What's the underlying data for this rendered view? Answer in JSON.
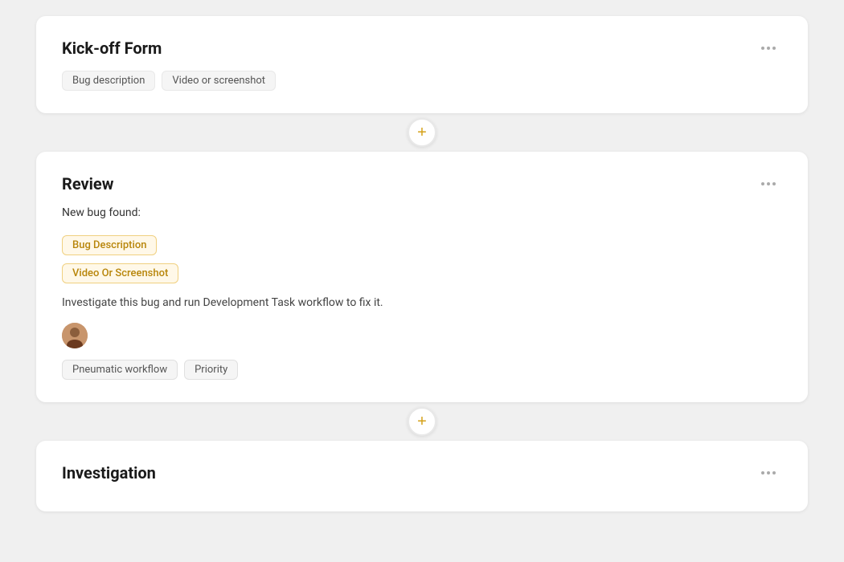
{
  "cards": [
    {
      "id": "kickoff",
      "title": "Kick-off Form",
      "tags": [
        "Bug description",
        "Video or screenshot"
      ],
      "dots_label": "options"
    },
    {
      "id": "review",
      "title": "Review",
      "new_bug_label": "New bug found:",
      "highlight_tags": [
        "Bug Description",
        "Video Or Screenshot"
      ],
      "investigate_text": "Investigate this bug and run Development Task workflow to fix it.",
      "workflow_tags": [
        "Pneumatic workflow",
        "Priority"
      ],
      "dots_label": "options"
    },
    {
      "id": "investigation",
      "title": "Investigation",
      "dots_label": "options"
    }
  ],
  "add_button_symbol": "+",
  "dots_symbol": "•••"
}
